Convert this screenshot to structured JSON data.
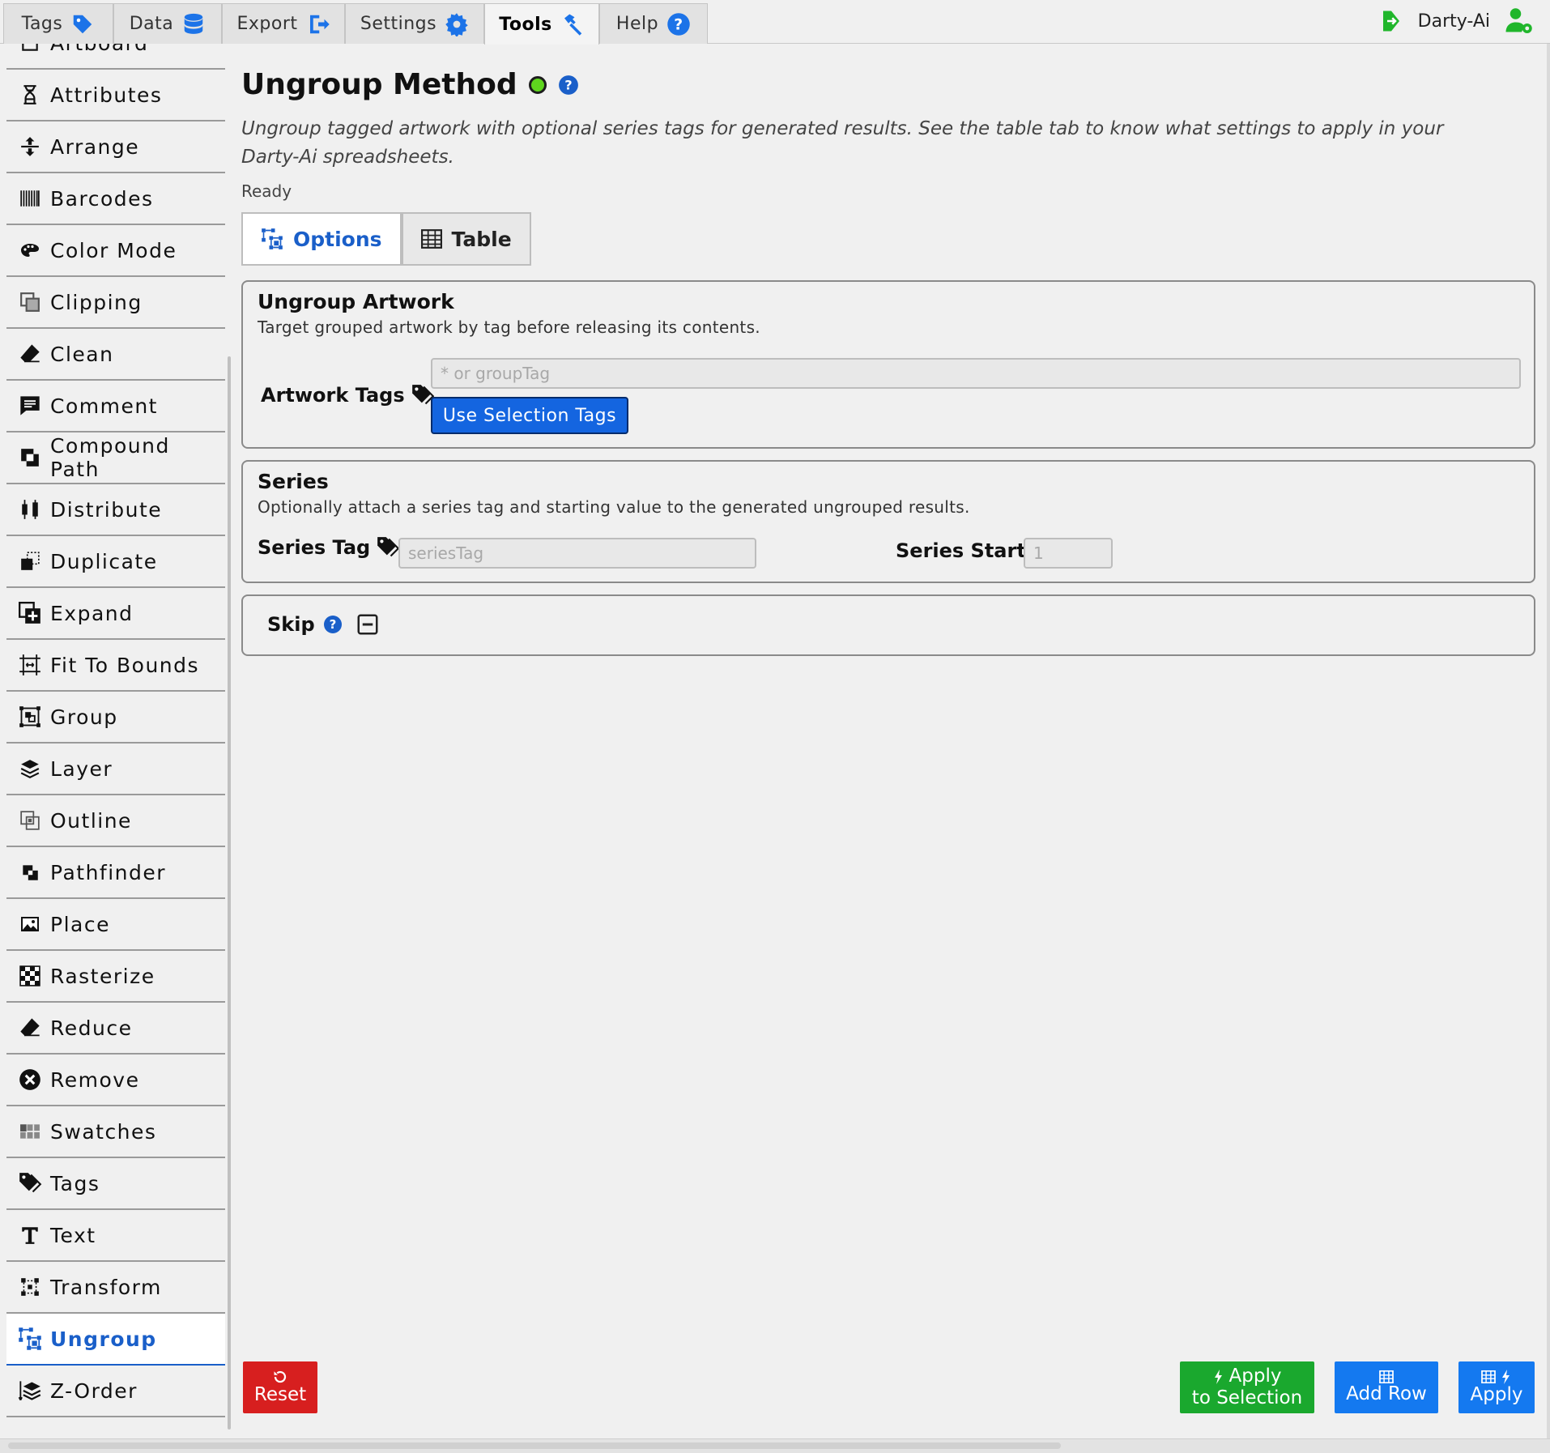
{
  "top_tabs": [
    {
      "label": "Tags",
      "icon": "tag-icon"
    },
    {
      "label": "Data",
      "icon": "database-icon"
    },
    {
      "label": "Export",
      "icon": "export-icon"
    },
    {
      "label": "Settings",
      "icon": "gear-icon"
    },
    {
      "label": "Tools",
      "icon": "hammer-icon",
      "active": true
    },
    {
      "label": "Help",
      "icon": "help-icon"
    }
  ],
  "user": {
    "name": "Darty-Ai"
  },
  "sidebar": {
    "items": [
      {
        "label": "Artboard",
        "icon": "artboard-icon"
      },
      {
        "label": "Attributes",
        "icon": "dna-icon"
      },
      {
        "label": "Arrange",
        "icon": "arrange-icon"
      },
      {
        "label": "Barcodes",
        "icon": "barcode-icon"
      },
      {
        "label": "Color Mode",
        "icon": "palette-icon"
      },
      {
        "label": "Clipping",
        "icon": "clipping-icon"
      },
      {
        "label": "Clean",
        "icon": "eraser-icon"
      },
      {
        "label": "Comment",
        "icon": "comment-icon"
      },
      {
        "label": "Compound Path",
        "icon": "compound-path-icon"
      },
      {
        "label": "Distribute",
        "icon": "distribute-icon"
      },
      {
        "label": "Duplicate",
        "icon": "duplicate-icon"
      },
      {
        "label": "Expand",
        "icon": "expand-icon"
      },
      {
        "label": "Fit To Bounds",
        "icon": "fit-bounds-icon"
      },
      {
        "label": "Group",
        "icon": "group-icon"
      },
      {
        "label": "Layer",
        "icon": "layers-icon"
      },
      {
        "label": "Outline",
        "icon": "outline-icon"
      },
      {
        "label": "Pathfinder",
        "icon": "pathfinder-icon"
      },
      {
        "label": "Place",
        "icon": "image-icon"
      },
      {
        "label": "Rasterize",
        "icon": "checkerboard-icon"
      },
      {
        "label": "Reduce",
        "icon": "eraser-icon"
      },
      {
        "label": "Remove",
        "icon": "remove-icon"
      },
      {
        "label": "Swatches",
        "icon": "swatches-icon"
      },
      {
        "label": "Tags",
        "icon": "tags-icon"
      },
      {
        "label": "Text",
        "icon": "text-icon"
      },
      {
        "label": "Transform",
        "icon": "transform-icon"
      },
      {
        "label": "Ungroup",
        "icon": "ungroup-icon",
        "active": true
      },
      {
        "label": "Z-Order",
        "icon": "z-order-icon"
      }
    ]
  },
  "main": {
    "title": "Ungroup Method",
    "description": "Ungroup tagged artwork with optional series tags for generated results. See the table tab to know what settings to apply in your Darty-Ai spreadsheets.",
    "status": "Ready",
    "tabs": [
      {
        "label": "Options",
        "active": true
      },
      {
        "label": "Table"
      }
    ],
    "ungroup_artwork": {
      "title": "Ungroup Artwork",
      "description": "Target grouped artwork by tag before releasing its contents.",
      "artwork_tags_label": "Artwork Tags",
      "artwork_tags_placeholder": "* or groupTag",
      "artwork_tags_value": "",
      "use_selection_label": "Use Selection Tags"
    },
    "series": {
      "title": "Series",
      "description": "Optionally attach a series tag and starting value to the generated ungrouped results.",
      "series_tag_label": "Series Tag",
      "series_tag_placeholder": "seriesTag",
      "series_tag_value": "",
      "series_start_label": "Series Start",
      "series_start_placeholder": "1",
      "series_start_value": ""
    },
    "skip": {
      "label": "Skip"
    }
  },
  "actions": {
    "reset": "Reset",
    "apply_selection_line1": "Apply",
    "apply_selection_line2": "to Selection",
    "add_row": "Add Row",
    "apply": "Apply"
  },
  "colors": {
    "accent": "#1a5fc9",
    "reset": "#d71f1f",
    "apply_selection": "#1aa82e",
    "add_row": "#1479f0",
    "apply": "#1479f0",
    "status_ready": "#5fd61e"
  }
}
